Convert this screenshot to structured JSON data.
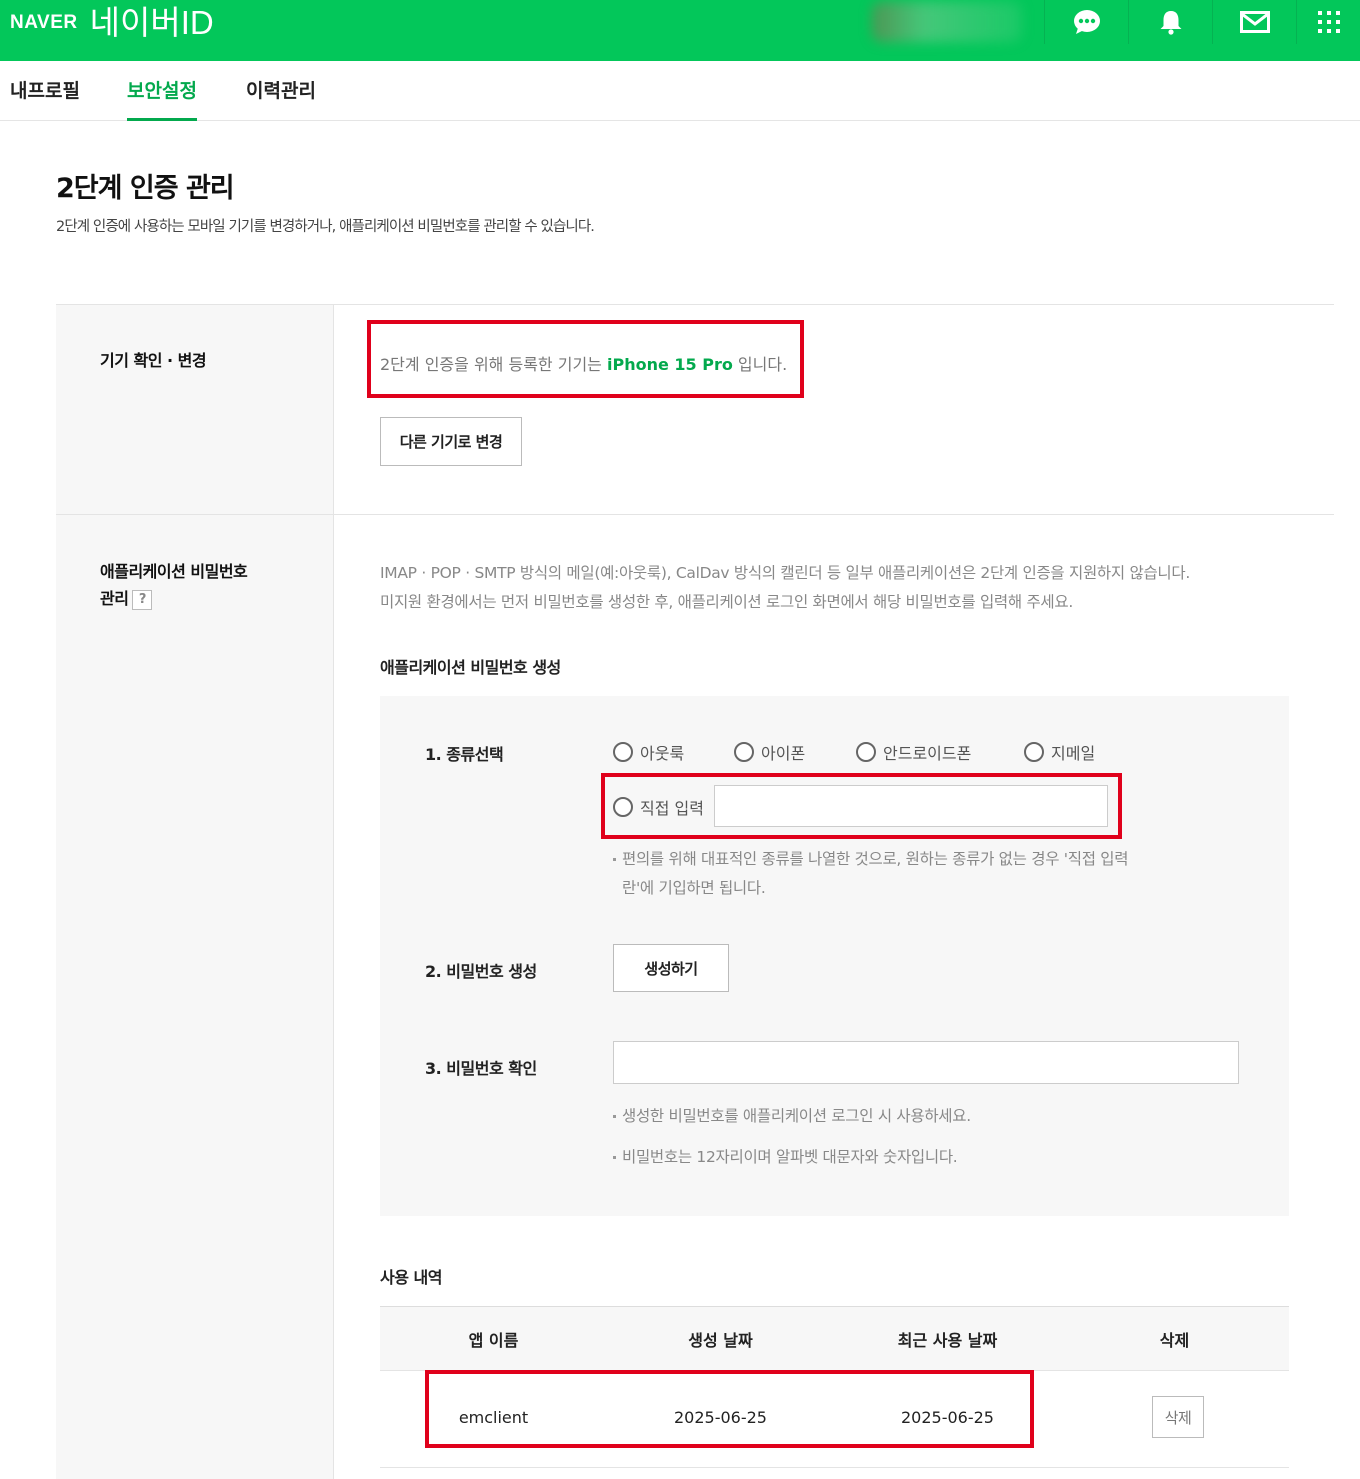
{
  "header": {
    "logo_naver": "NAVER",
    "logo_id": "네이버ID",
    "icons": [
      "chat-icon",
      "bell-icon",
      "mail-icon",
      "apps-grid-icon"
    ],
    "brand_color": "#03c75a"
  },
  "tabs": [
    {
      "label": "내프로필",
      "active": false
    },
    {
      "label": "보안설정",
      "active": true
    },
    {
      "label": "이력관리",
      "active": false
    }
  ],
  "page": {
    "title": "2단계 인증 관리",
    "description": "2단계 인증에 사용하는 모바일 기기를 변경하거나, 애플리케이션 비밀번호를 관리할 수 있습니다."
  },
  "device_section": {
    "label": "기기 확인 · 변경",
    "text_before": "2단계 인증을 위해 등록한 기기는 ",
    "device_name": "iPhone 15 Pro",
    "text_after": " 입니다.",
    "change_button": "다른 기기로 변경"
  },
  "app_password_section": {
    "label_line1": "애플리케이션 비밀번호",
    "label_line2": "관리",
    "help_icon": "?",
    "info_line1": "IMAP · POP · SMTP 방식의 메일(예:아웃룩), CalDav 방식의 캘린더 등 일부 애플리케이션은 2단계 인증을 지원하지 않습니다.",
    "info_line2": "미지원 환경에서는 먼저 비밀번호를 생성한 후, 애플리케이션 로그인 화면에서 해당 비밀번호를 입력해 주세요.",
    "generate_title": "애플리케이션 비밀번호 생성",
    "step1_label": "1. 종류선택",
    "radio_options": [
      "아웃룩",
      "아이폰",
      "안드로이드폰",
      "지메일"
    ],
    "radio_custom": "직접 입력",
    "custom_input_value": "",
    "step1_note_line1": "편의를 위해 대표적인 종류를 나열한 것으로, 원하는 종류가 없는 경우 '직접 입력",
    "step1_note_line2": "란'에 기입하면 됩니다.",
    "step2_label": "2. 비밀번호 생성",
    "generate_button": "생성하기",
    "step3_label": "3. 비밀번호 확인",
    "password_value": "",
    "step3_note1": "생성한 비밀번호를 애플리케이션 로그인 시 사용하세요.",
    "step3_note2": "비밀번호는 12자리이며 알파벳 대문자와 숫자입니다."
  },
  "usage": {
    "title": "사용 내역",
    "columns": [
      "앱 이름",
      "생성 날짜",
      "최근 사용 날짜",
      "삭제"
    ],
    "rows": [
      {
        "app": "emclient",
        "created": "2025-06-25",
        "last_used": "2025-06-25",
        "delete_label": "삭제"
      }
    ]
  },
  "highlight_color": "#e0001b",
  "accent_color": "#03a94d"
}
